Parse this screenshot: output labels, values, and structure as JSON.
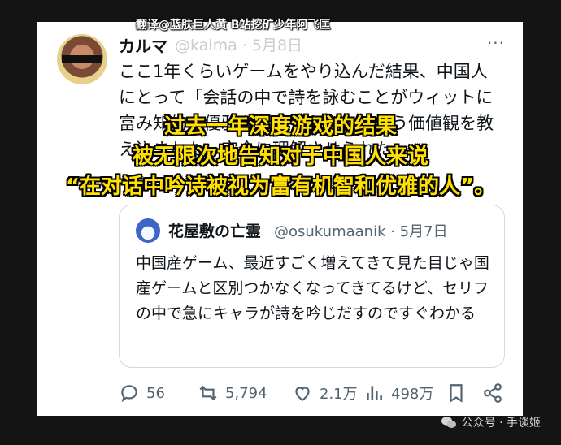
{
  "colors": {
    "overlay_text": "#ffe000",
    "card_bg": "#ffffff",
    "page_bg": "#141414"
  },
  "tweet": {
    "author": "カルマ",
    "meta_faded": "@kalma · 5月8日",
    "more": "···",
    "watermark": "翻译@蓝肤巨人黄 B站挖矿少年阿飞匡",
    "text": "ここ1年くらいゲームをやり込んだ結果、中国人にとって「会話の中で詩を詠むことがウィットに富み知的で優雅な行いである」という価値観を教え込まれた。完全に理解させられた。"
  },
  "overlay": {
    "line1": "过去一年深度游戏的结果",
    "line2": "被无限次地告知对于中国人来说",
    "line3": "“在对话中吟诗被视为富有机智和优雅的人”。"
  },
  "quote": {
    "name": "花屋敷の亡霊",
    "meta": "@osukumaanik · 5月7日",
    "text": "中国産ゲーム、最近すごく増えてきて見た目じゃ国産ゲームと区別つかなくなってきてるけど、セリフの中で急にキャラが詩を吟じだすのですぐわかる"
  },
  "actions": {
    "replies": "56",
    "retweets": "5,794",
    "likes": "2.1万",
    "views": "498万"
  },
  "footer": {
    "wechat": "公众号 · 手谈姬"
  }
}
